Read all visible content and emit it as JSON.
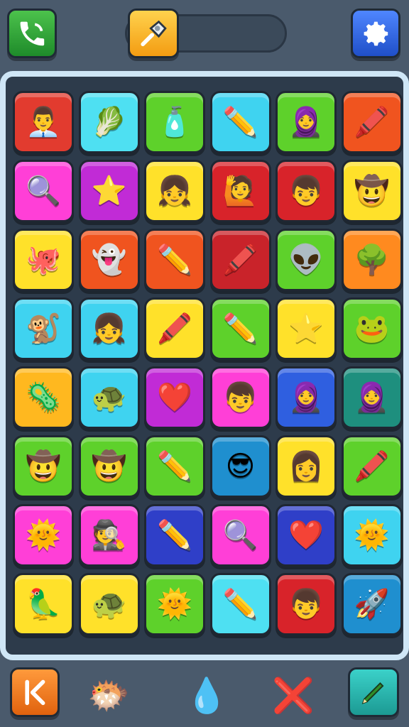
{
  "topbar": {
    "call_icon": "phone-icon",
    "tool_icon": "trowel-icon",
    "settings_icon": "gear-icon",
    "progress_level": 0.0
  },
  "board": {
    "rows": 8,
    "cols": 6,
    "tiles": [
      {
        "bg": "#e23b2f",
        "icon": "👨‍💼",
        "name": "boy-in-suit"
      },
      {
        "bg": "#4ee0f2",
        "icon": "🥬",
        "name": "vegetable-bundle"
      },
      {
        "bg": "#5ed12b",
        "icon": "🧴",
        "name": "yellow-cup"
      },
      {
        "bg": "#3fd3f0",
        "icon": "✏️",
        "name": "blue-pencil"
      },
      {
        "bg": "#5ed12b",
        "icon": "🧕",
        "name": "hijab-girl"
      },
      {
        "bg": "#f0541f",
        "icon": "🖍️",
        "name": "red-pencil"
      },
      {
        "bg": "#ff3fd7",
        "icon": "🔍",
        "name": "magnifier"
      },
      {
        "bg": "#c12bd6",
        "icon": "⭐",
        "name": "orange-star"
      },
      {
        "bg": "#ffe12a",
        "icon": "👧",
        "name": "blonde-girl"
      },
      {
        "bg": "#d8232a",
        "icon": "🙋",
        "name": "girl-waving"
      },
      {
        "bg": "#d8232a",
        "icon": "👦",
        "name": "boy-bear-ears"
      },
      {
        "bg": "#ffe12a",
        "icon": "🤠",
        "name": "boy-green-hat"
      },
      {
        "bg": "#ffe12a",
        "icon": "🐙",
        "name": "red-octopus"
      },
      {
        "bg": "#f0541f",
        "icon": "👻",
        "name": "white-ghost"
      },
      {
        "bg": "#f0541f",
        "icon": "✏️",
        "name": "blue-pencil"
      },
      {
        "bg": "#c9232a",
        "icon": "🖍️",
        "name": "purple-pencil"
      },
      {
        "bg": "#5ed12b",
        "icon": "👽",
        "name": "green-alien"
      },
      {
        "bg": "#ff8a1f",
        "icon": "🌳",
        "name": "green-tree"
      },
      {
        "bg": "#3fd3f0",
        "icon": "🐒",
        "name": "grey-monkey"
      },
      {
        "bg": "#3fd3f0",
        "icon": "👧",
        "name": "girl-buns"
      },
      {
        "bg": "#ffe12a",
        "icon": "🖍️",
        "name": "red-pencil"
      },
      {
        "bg": "#5ed12b",
        "icon": "✏️",
        "name": "green-pencil"
      },
      {
        "bg": "#ffe12a",
        "icon": "⭐",
        "name": "red-star"
      },
      {
        "bg": "#5ed12b",
        "icon": "🐸",
        "name": "green-creature"
      },
      {
        "bg": "#ffb81f",
        "icon": "🦠",
        "name": "green-germ"
      },
      {
        "bg": "#3fd3f0",
        "icon": "🐢",
        "name": "green-turtle"
      },
      {
        "bg": "#c12bd6",
        "icon": "❤️",
        "name": "red-heart"
      },
      {
        "bg": "#ff3fd7",
        "icon": "👦",
        "name": "boy-smiling"
      },
      {
        "bg": "#2f5fe0",
        "icon": "🧕",
        "name": "hijab-girl-waving"
      },
      {
        "bg": "#1e8f7e",
        "icon": "🧕",
        "name": "hijab-girl-teal"
      },
      {
        "bg": "#5ed12b",
        "icon": "🤠",
        "name": "boy-brown-hat"
      },
      {
        "bg": "#5ed12b",
        "icon": "🤠",
        "name": "boy-green-hat"
      },
      {
        "bg": "#5ed12b",
        "icon": "✏️",
        "name": "blue-pencil"
      },
      {
        "bg": "#1f8fcf",
        "icon": "😎",
        "name": "captain-sunglasses"
      },
      {
        "bg": "#ffe12a",
        "icon": "👩",
        "name": "girl-black-hair"
      },
      {
        "bg": "#5ed12b",
        "icon": "🖍️",
        "name": "orange-pencil"
      },
      {
        "bg": "#ff3fd7",
        "icon": "🌞",
        "name": "sun-face"
      },
      {
        "bg": "#ff3fd7",
        "icon": "🕵️",
        "name": "boy-hat-glasses"
      },
      {
        "bg": "#2f3fc8",
        "icon": "✏️",
        "name": "yellow-pencil"
      },
      {
        "bg": "#ff3fd7",
        "icon": "🔍",
        "name": "pink-magnifier"
      },
      {
        "bg": "#2f3fc8",
        "icon": "❤️",
        "name": "red-heart"
      },
      {
        "bg": "#3fd3f0",
        "icon": "🌞",
        "name": "orange-sun"
      },
      {
        "bg": "#ffe12a",
        "icon": "🦜",
        "name": "green-parrot"
      },
      {
        "bg": "#ffe12a",
        "icon": "🐢",
        "name": "green-turtle"
      },
      {
        "bg": "#5ed12b",
        "icon": "🌞",
        "name": "orange-sun"
      },
      {
        "bg": "#4ee0f2",
        "icon": "✏️",
        "name": "blue-pencil"
      },
      {
        "bg": "#d8232a",
        "icon": "👦",
        "name": "boy-bear-ears"
      },
      {
        "bg": "#1f8fcf",
        "icon": "🚀",
        "name": "rocket"
      }
    ]
  },
  "bottombar": {
    "back_icon": "back-icon",
    "buddy_icon": "blue-creature-icon",
    "drop_icon": "blue-drop-icon",
    "pencil_x_icon": "crossed-pencil-icon",
    "pencil_icon": "green-pencil-icon"
  }
}
